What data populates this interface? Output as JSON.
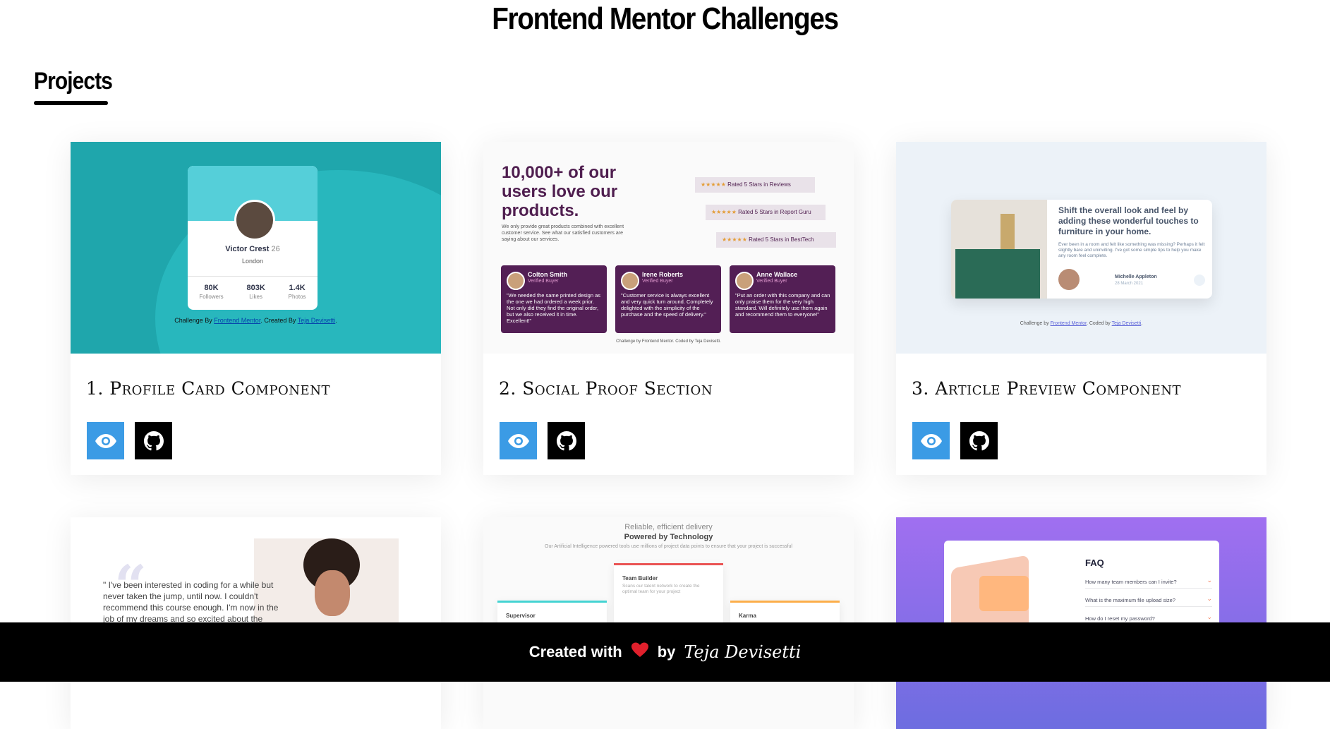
{
  "page": {
    "title": "Frontend Mentor Challenges",
    "section_title": "Projects"
  },
  "projects": [
    {
      "title": "1. Profile Card Component",
      "preview": {
        "name": "Victor Crest",
        "age": "26",
        "location": "London",
        "stats": [
          {
            "value": "80K",
            "label": "Followers"
          },
          {
            "value": "803K",
            "label": "Likes"
          },
          {
            "value": "1.4K",
            "label": "Photos"
          }
        ],
        "credit_prefix": "Challenge By ",
        "credit_link1": "Frontend Mentor",
        "credit_mid": ". Created By ",
        "credit_link2": "Teja Devisetti",
        "credit_suffix": "."
      }
    },
    {
      "title": "2. Social Proof Section",
      "preview": {
        "heading": "10,000+ of our users love our products.",
        "sub": "We only provide great products combined with excellent customer service. See what our satisfied customers are saying about our services.",
        "ratings": [
          "Rated 5 Stars in Reviews",
          "Rated 5 Stars in Report Guru",
          "Rated 5 Stars in BestTech"
        ],
        "stars": "★★★★★",
        "reviews": [
          {
            "name": "Colton Smith",
            "tag": "Verified Buyer",
            "text": "\"We needed the same printed design as the one we had ordered a week prior. Not only did they find the original order, but we also received it in time. Excellent!\""
          },
          {
            "name": "Irene Roberts",
            "tag": "Verified Buyer",
            "text": "\"Customer service is always excellent and very quick turn around. Completely delighted with the simplicity of the purchase and the speed of delivery.\""
          },
          {
            "name": "Anne Wallace",
            "tag": "Verified Buyer",
            "text": "\"Put an order with this company and can only praise them for the very high standard. Will definitely use them again and recommend them to everyone!\""
          }
        ],
        "credit": "Challenge by Frontend Mentor. Coded by Teja Devisetti."
      }
    },
    {
      "title": "3. Article Preview Component",
      "preview": {
        "heading": "Shift the overall look and feel by adding these wonderful touches to furniture in your home.",
        "body": "Ever been in a room and felt like something was missing? Perhaps it felt slightly bare and uninviting. I've got some simple tips to help you make any room feel complete.",
        "author": "Michelle Appleton",
        "date": "28 March 2021",
        "credit_prefix": "Challenge by ",
        "credit_link1": "Frontend Mentor",
        "credit_mid": ". Coded by ",
        "credit_link2": "Teja Devisetti",
        "credit_suffix": "."
      }
    },
    {
      "title": "",
      "preview": {
        "quote": "\" I've been interested in coding for a while but never taken the jump, until now. I couldn't recommend this course enough. I'm now in the job of my dreams and so excited about the"
      }
    },
    {
      "title": "",
      "preview": {
        "line1": "Reliable, efficient delivery",
        "line2": "Powered by Technology",
        "para": "Our Artificial Intelligence powered tools use millions of project data points to ensure that your project is successful",
        "cards": [
          {
            "title": "Supervisor",
            "text": ""
          },
          {
            "title": "Team Builder",
            "text": "Scans our talent network to create the optimal team for your project"
          },
          {
            "title": "Karma",
            "text": ""
          }
        ]
      }
    },
    {
      "title": "",
      "preview": {
        "heading": "FAQ",
        "questions": [
          "How many team members can I invite?",
          "What is the maximum file upload size?",
          "How do I reset my password?"
        ]
      }
    }
  ],
  "buttons": {
    "view_icon": "eye-icon",
    "code_icon": "github-icon"
  },
  "footer": {
    "created_with": "Created with",
    "by": "by",
    "author": "Teja Devisetti",
    "heart_color": "#e0202c"
  },
  "colors": {
    "view_button": "#3b9be5",
    "code_button": "#000000",
    "footer_bg": "#000000"
  }
}
